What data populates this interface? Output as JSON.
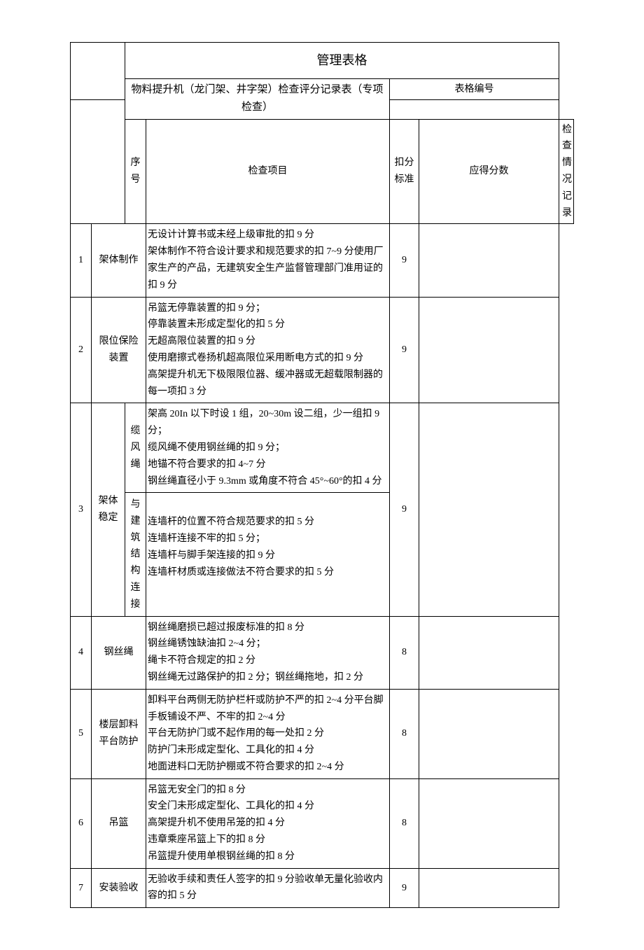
{
  "title": "管理表格",
  "subtitle": "物料提升机（龙门架、井字架）检查评分记录表（专项检查）",
  "formNumberLabel": "表格编号",
  "headers": {
    "seq": "序号",
    "item": "检查项目",
    "criteria": "扣分标准",
    "score": "应得分数",
    "notes": "检查情况记录"
  },
  "subItems": {
    "cableWind": "缆风绳",
    "buildingConnect": "与建筑结构连接"
  },
  "rows": [
    {
      "seq": "1",
      "item": "架体制作",
      "criteria": "无设计计算书或未经上级审批的扣 9 分\n架体制作不符合设计要求和规范要求的扣 7~9 分使用厂家生产的产品，无建筑安全生产监督管理部门准用证的扣 9 分",
      "score": "9"
    },
    {
      "seq": "2",
      "item": "限位保险装置",
      "criteria": "吊篮无停靠装置的扣 9 分；\n停靠装置未形成定型化的扣 5 分\n无超高限位装置的扣 9 分\n使用磨擦式卷扬机超高限位采用断电方式的扣 9 分\n高架提升机无下极限限位器、缓冲器或无超载限制器的每一项扣 3 分",
      "score": "9"
    },
    {
      "seq": "3",
      "item": "架体稳定",
      "subCriteria1": "架高 20In 以下时设 1 组，20~30m 设二组，少一组扣 9 分；\n缆风绳不使用钢丝绳的扣 9 分；\n地锚不符合要求的扣 4~7 分\n钢丝绳直径小于 9.3mm 或角度不符合 45°~60°的扣 4 分",
      "subCriteria2": "连墙杆的位置不符合规范要求的扣 5 分\n连墙杆连接不牢的扣 5 分；\n连墙杆与脚手架连接的扣 9 分\n连墙杆材质或连接做法不符合要求的扣 5 分",
      "score": "9"
    },
    {
      "seq": "4",
      "item": "钢丝绳",
      "criteria": "钢丝绳磨损已超过报废标准的扣 8 分\n钢丝绳锈蚀缺油扣 2~4 分；\n绳卡不符合规定的扣 2 分\n钢丝绳无过路保护的扣 2 分；钢丝绳拖地，扣 2 分",
      "score": "8"
    },
    {
      "seq": "5",
      "item": "楼层卸料平台防护",
      "criteria": "卸料平台两侧无防护栏杆或防护不严的扣 2~4 分平台脚手板铺设不严、不牢的扣 2~4 分\n平台无防护门或不起作用的每一处扣 2 分\n防护门未形成定型化、工具化的扣 4 分\n地面进料口无防护棚或不符合要求的扣 2~4 分",
      "score": "8"
    },
    {
      "seq": "6",
      "item": "吊篮",
      "criteria": "吊篮无安全门的扣 8 分\n安全门未形成定型化、工具化的扣 4 分\n高架提升机不使用吊笼的扣 4 分\n违章乘座吊篮上下的扣 8 分\n吊篮提升使用单根钢丝绳的扣 8 分",
      "score": "8"
    },
    {
      "seq": "7",
      "item": "安装验收",
      "criteria": "无验收手续和责任人签字的扣 9 分验收单无量化验收内容的扣 5 分",
      "score": "9"
    }
  ]
}
